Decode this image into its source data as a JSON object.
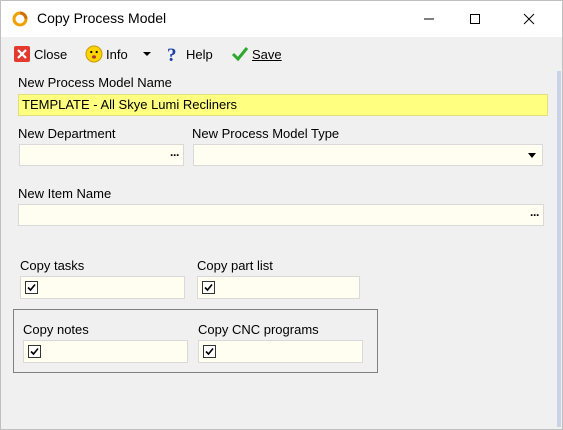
{
  "window": {
    "title": "Copy Process Model",
    "icon": "process-ring-icon",
    "controls": {
      "minimize": "minimize-icon",
      "maximize": "maximize-icon",
      "close": "close-icon"
    }
  },
  "toolbar": {
    "close_label": "Close",
    "info_label": "Info",
    "help_label": "Help",
    "save_label": "Save",
    "icons": {
      "close": "red-x-icon",
      "info": "smiley-icon",
      "info_menu": "dropdown-arrow-icon",
      "help": "question-mark-icon",
      "save": "green-check-icon"
    }
  },
  "form": {
    "process_model_name": {
      "label": "New Process Model Name",
      "value": "TEMPLATE - All Skye Lumi Recliners"
    },
    "department": {
      "label": "New Department",
      "value": ""
    },
    "process_model_type": {
      "label": "New Process Model Type",
      "value": ""
    },
    "item_name": {
      "label": "New Item Name",
      "value": ""
    },
    "copy_tasks": {
      "label": "Copy tasks",
      "checked": true
    },
    "copy_part_list": {
      "label": "Copy part list",
      "checked": true
    },
    "copy_notes": {
      "label": "Copy notes",
      "checked": true
    },
    "copy_cnc_programs": {
      "label": "Copy CNC programs",
      "checked": true
    }
  },
  "colors": {
    "highlight_field": "#ffff80",
    "field_bg": "#fffef0",
    "window_bg": "#f0f0f0"
  }
}
